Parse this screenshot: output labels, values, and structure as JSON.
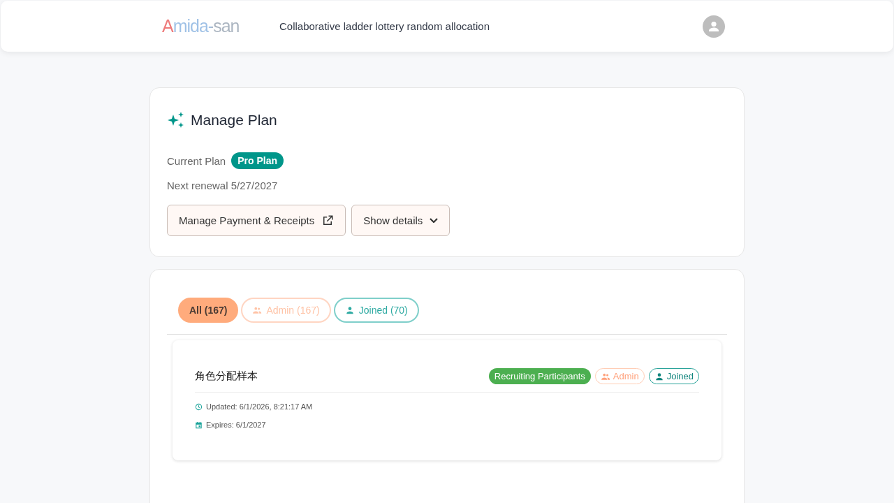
{
  "header": {
    "logo": "Amida-san",
    "tagline": "Collaborative ladder lottery random allocation"
  },
  "plan": {
    "title": "Manage Plan",
    "current_label": "Current Plan",
    "plan_name": "Pro Plan",
    "renewal": "Next renewal 5/27/2027",
    "buttons": [
      {
        "kind": "external",
        "label": "Manage Payment & Receipts"
      },
      {
        "kind": "expand",
        "label": "Show details"
      }
    ]
  },
  "tabs": [
    {
      "kind": "all",
      "label": "All (167)",
      "selected": true
    },
    {
      "kind": "admin",
      "label": "Admin (167)",
      "selected": false
    },
    {
      "kind": "joined",
      "label": "Joined (70)",
      "selected": false
    }
  ],
  "items": [
    {
      "title": "角色分配样本",
      "status": {
        "label": "Recruiting Participants",
        "color": "#4caf50"
      },
      "roles": [
        {
          "kind": "admin",
          "label": "Admin"
        },
        {
          "kind": "joined",
          "label": "Joined"
        }
      ],
      "meta": [
        {
          "kind": "updated",
          "text": "Updated: 6/1/2026, 8:21:17 AM"
        },
        {
          "kind": "expires",
          "text": "Expires: 6/1/2027"
        }
      ]
    }
  ]
}
